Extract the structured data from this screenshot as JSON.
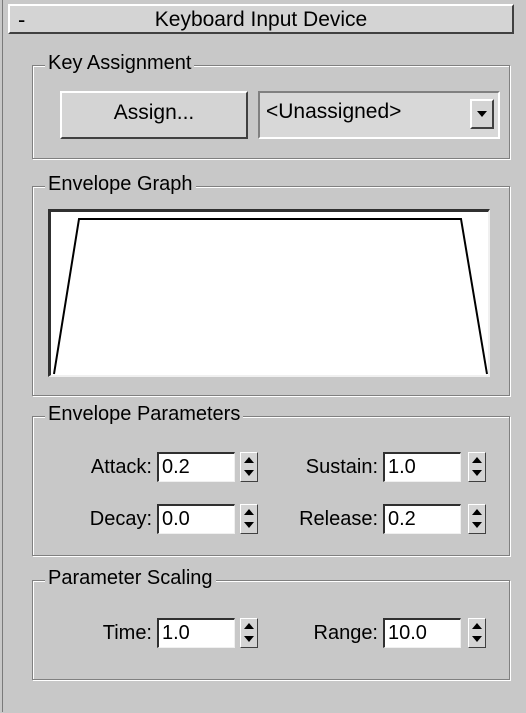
{
  "rollout": {
    "collapse_symbol": "-",
    "title": "Keyboard Input Device"
  },
  "key_assignment": {
    "label": "Key Assignment",
    "assign_label": "Assign...",
    "selected_key": "<Unassigned>"
  },
  "envelope_graph": {
    "label": "Envelope Graph"
  },
  "envelope_parameters": {
    "label": "Envelope Parameters",
    "attack_label": "Attack:",
    "attack_value": "0.2",
    "sustain_label": "Sustain:",
    "sustain_value": "1.0",
    "decay_label": "Decay:",
    "decay_value": "0.0",
    "release_label": "Release:",
    "release_value": "0.2"
  },
  "parameter_scaling": {
    "label": "Parameter Scaling",
    "time_label": "Time:",
    "time_value": "1.0",
    "range_label": "Range:",
    "range_value": "10.0"
  }
}
